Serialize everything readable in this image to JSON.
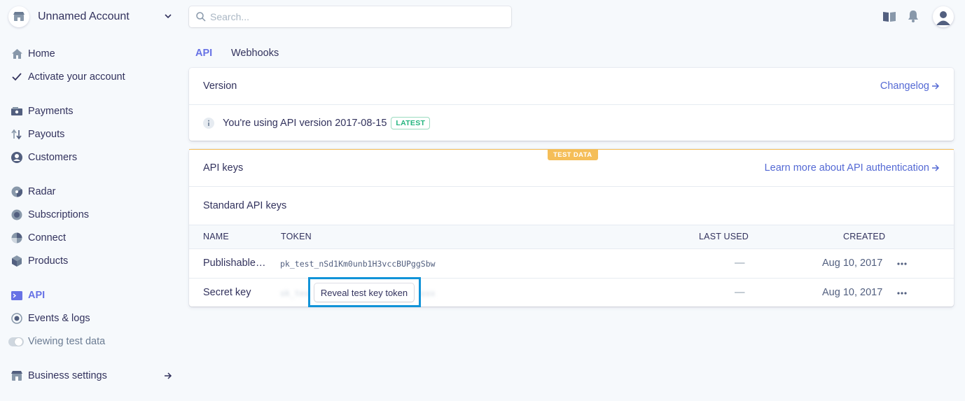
{
  "account": {
    "name": "Unnamed Account"
  },
  "search": {
    "placeholder": "Search..."
  },
  "nav": {
    "home": "Home",
    "activate": "Activate your account",
    "payments": "Payments",
    "payouts": "Payouts",
    "customers": "Customers",
    "radar": "Radar",
    "subscriptions": "Subscriptions",
    "connect": "Connect",
    "products": "Products",
    "api": "API",
    "events": "Events & logs",
    "viewing_test": "Viewing test data",
    "business_settings": "Business settings"
  },
  "tabs": {
    "api": "API",
    "webhooks": "Webhooks"
  },
  "version_card": {
    "title": "Version",
    "changelog": "Changelog",
    "message": "You're using API version 2017-08-15",
    "badge": "LATEST"
  },
  "keys_card": {
    "test_badge": "TEST DATA",
    "title": "API keys",
    "learn_more": "Learn more about API authentication",
    "section_title": "Standard API keys",
    "columns": {
      "name": "NAME",
      "token": "TOKEN",
      "last_used": "LAST USED",
      "created": "CREATED"
    },
    "rows": [
      {
        "name": "Publishable…",
        "token": "pk_test_nSd1Km0unb1H3vccBUPggSbw",
        "last_used": "—",
        "created": "Aug 10, 2017"
      },
      {
        "name": "Secret key",
        "token_hidden": "sk_test_xxxxxxxxxxxxxxxxxxxxxxxx",
        "reveal_label": "Reveal test key token",
        "last_used": "—",
        "created": "Aug 10, 2017"
      }
    ]
  },
  "colors": {
    "accent": "#6772e5",
    "link": "#5469d4",
    "test": "#f5be58",
    "highlight": "#1193d8"
  }
}
